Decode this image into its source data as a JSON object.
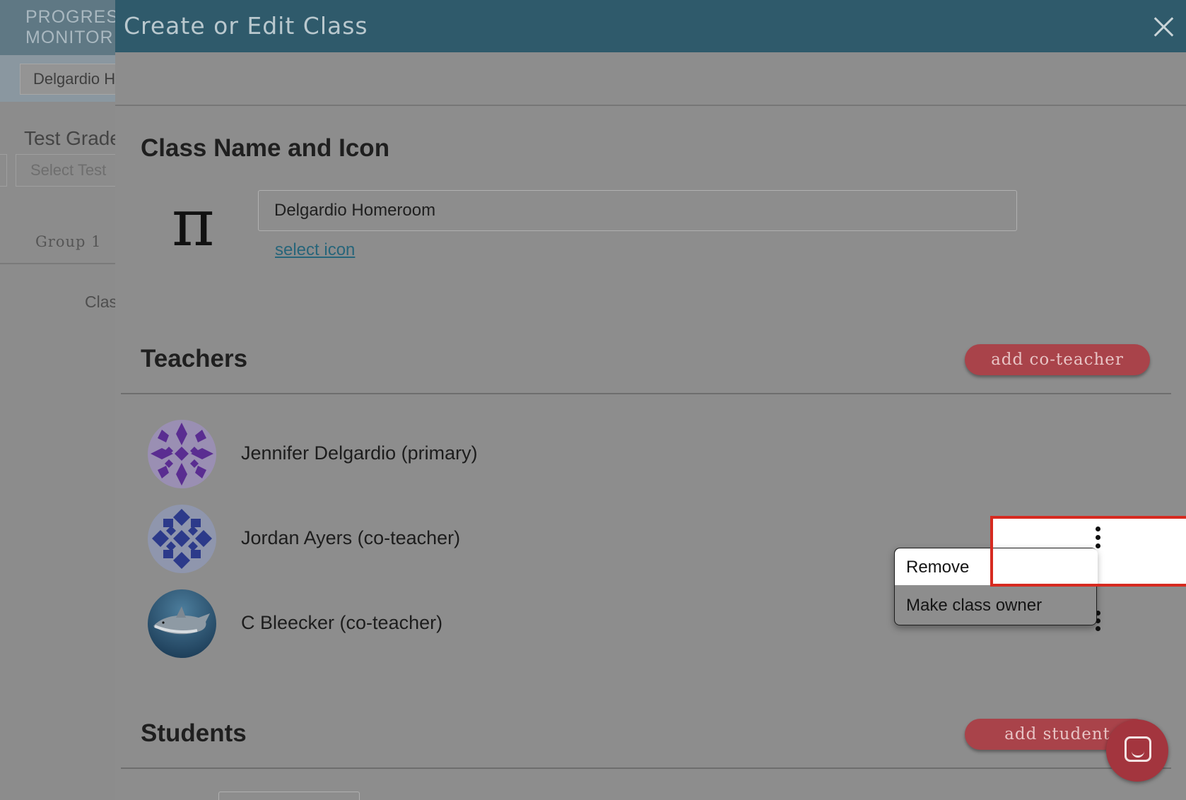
{
  "background": {
    "logo_line1": "PROGRESS",
    "logo_line2": "MONITOR",
    "school_select_value": "Delgardio Homeroom",
    "test_grade_label": "Test Grade",
    "test_select_placeholder": "Select Test",
    "group_tab": "Group 1",
    "class_text": "Class"
  },
  "modal": {
    "title": "Create or Edit Class",
    "class_section": {
      "heading": "Class Name and Icon",
      "icon_glyph": "π",
      "class_name_value": "Delgardio Homeroom",
      "select_icon_link": "select icon"
    },
    "teachers_section": {
      "heading": "Teachers",
      "add_button": "add co-teacher",
      "teachers": [
        {
          "name": "Jennifer Delgardio (primary)",
          "avatar": "purple-pattern-avatar"
        },
        {
          "name": "Jordan Ayers (co-teacher)",
          "avatar": "blue-pattern-avatar"
        },
        {
          "name": "C Bleecker (co-teacher)",
          "avatar": "shark-photo-avatar"
        }
      ]
    },
    "teacher_menu": {
      "items": [
        "Remove",
        "Make class owner"
      ]
    },
    "students_section": {
      "heading": "Students",
      "add_button": "add student"
    }
  },
  "colors": {
    "header": "#2f5a6b",
    "accent_button": "#a9434a",
    "highlight": "#d62a20",
    "link": "#27657a"
  }
}
